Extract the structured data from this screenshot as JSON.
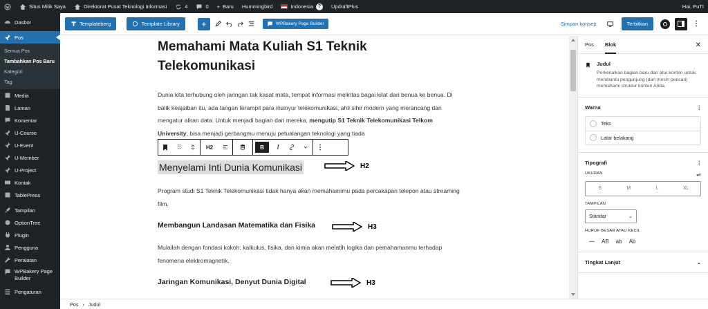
{
  "adminbar": {
    "site": "Situs Milik Saya",
    "directorate": "Direktorat Pusat Teknologi Informasi",
    "updates": "4",
    "comments": "0",
    "new": "Baru",
    "hummingbird": "Hummingbird",
    "language": "Indonesia",
    "updraft": "UpdraftPlus",
    "greeting": "Hai, PuTI"
  },
  "sidebar": {
    "items": [
      {
        "label": "Dasbor",
        "icon": "dashboard-icon"
      },
      {
        "label": "Pos",
        "icon": "pin-icon"
      },
      {
        "label": "Media",
        "icon": "media-icon"
      },
      {
        "label": "Laman",
        "icon": "page-icon"
      },
      {
        "label": "Komentar",
        "icon": "comment-icon"
      },
      {
        "label": "U-Course",
        "icon": "pin-icon"
      },
      {
        "label": "U-Event",
        "icon": "pin-icon"
      },
      {
        "label": "U-Member",
        "icon": "pin-icon"
      },
      {
        "label": "U-Project",
        "icon": "pin-icon"
      },
      {
        "label": "Kontak",
        "icon": "mail-icon"
      },
      {
        "label": "TablePress",
        "icon": "table-icon"
      },
      {
        "label": "Tampilan",
        "icon": "brush-icon"
      },
      {
        "label": "OptionTree",
        "icon": "options-icon"
      },
      {
        "label": "Plugin",
        "icon": "plugin-icon"
      },
      {
        "label": "Pengguna",
        "icon": "user-icon"
      },
      {
        "label": "Peralatan",
        "icon": "wrench-icon"
      },
      {
        "label": "WPBakery Page Builder",
        "icon": "wpbakery-icon"
      },
      {
        "label": "Pengaturan",
        "icon": "settings-icon"
      }
    ],
    "submenu": [
      "Semua Pos",
      "Tambahkan Pos Baru",
      "Kategori",
      "Tag"
    ]
  },
  "toolbar": {
    "templateberg": "Templateberg",
    "template_library": "Template Library",
    "wpbakery": "WPBakery Page Builder",
    "save_draft": "Simpan konsep",
    "publish": "Terbitkan"
  },
  "editor": {
    "title": "Memahami Mata Kuliah S1 Teknik Telekomunikasi",
    "para1_a": "Dunia kita terhubung oleh jaringan tak kasat mata, tempat informasi melintas bagai kilat dari benua ke benua. Di balik keajaiban itu, ada tangan terampil para insinyur telekomunikasi, ahli sihir modern yang merancang dan mengatur aliran data. Untuk menjadi bagian dari mereka, ",
    "para1_bold": "mengutip S1 Teknik Telekomunikasi Telkom University",
    "para1_b": ", bisa menjadi gerbangmu menuju petualangan teknologi yang tiada",
    "h2": "Menyelami Inti Dunia Komunikasi",
    "para2": "Program studi S1 Teknik Telekomunikasi tidak hanya akan memahamimu pada percakapan telepon atau streaming film.",
    "h3a": "Membangun Landasan Matematika dan Fisika",
    "para3": "Mulailah dengan fondasi kokoh: kalkulus, fisika, dan kimia akan melatih logika dan pemahamanmu terhadap fenomena elektromagnetik.",
    "h3b": "Jaringan Komunikasi, Denyut Dunia Digital"
  },
  "annotations": {
    "a1": "H2",
    "a2": "H3",
    "a3": "H3"
  },
  "blocktoolbar": {
    "level": "H2",
    "bold": "B",
    "italic": "I"
  },
  "settings": {
    "tab_post": "Pos",
    "tab_block": "Blok",
    "block_name": "Judul",
    "block_desc": "Perkenalkan bagian baru dan atur konten untuk membantu pengunjung (dan mesin pencari) memahami struktur konten Anda.",
    "color_title": "Warna",
    "text": "Teks",
    "background": "Latar belakang",
    "typo_title": "Tipografi",
    "size_label": "UKURAN",
    "sizes": [
      "S",
      "M",
      "L",
      "XL"
    ],
    "appearance_label": "TAMPILAN",
    "appearance_value": "Standar",
    "case_label": "HURUF BESAR ATAU KECIL",
    "cases": [
      "—",
      "AB",
      "ab",
      "Ab"
    ],
    "advanced": "Tingkat Lanjut"
  },
  "footer": {
    "crumb1": "Pos",
    "crumb2": "Judul"
  },
  "colors": {
    "accent": "#2271b1",
    "admin_dark": "#1d2327"
  }
}
